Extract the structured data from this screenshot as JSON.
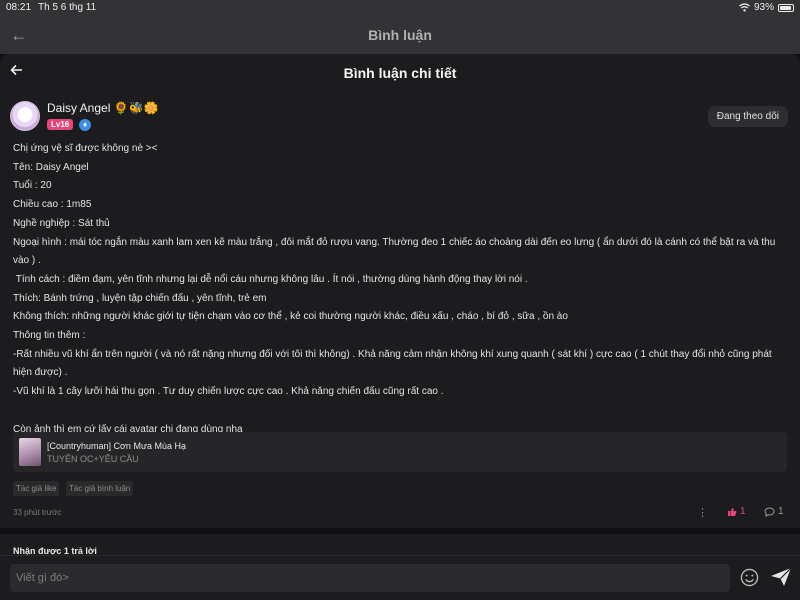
{
  "status_bar": {
    "time": "08:21",
    "date": "Th 5 6 thg 11",
    "battery": "93%",
    "battery_level": 0.93
  },
  "background_header": {
    "title": "Bình luận"
  },
  "sheet": {
    "title": "Bình luận chi tiết"
  },
  "user": {
    "name": "Daisy Angel 🌻🐝🌼",
    "level": "Lv16",
    "follow_label": "Đang theo dõi"
  },
  "comment": {
    "lines": [
      "Chị ứng vệ sĩ được không nè ><",
      "Tên: Daisy Angel",
      "Tuổi : 20",
      "Chiều cao : 1m85",
      "Nghề nghiệp : Sát thủ",
      "Ngoại hình : mái tóc ngắn màu xanh lam xen kẽ màu trắng , đôi mắt đỏ rượu vang. Thường đeo 1 chiếc áo choàng dài đến eo lưng ( ẩn dưới đó là cánh có thể bật ra và thu vào ) .",
      " Tính cách : điềm đạm, yên tĩnh nhưng lại dễ nổi cáu nhưng không lâu . Ít nói , thường dùng hành động thay lời nói .",
      "Thích: Bánh trứng , luyện tập chiến đấu , yên tĩnh, trẻ em",
      "Không thích: những người khác giới tự tiện chạm vào cơ thể , kẻ coi thường người khác, điều xấu , cháo , bí đỏ , sữa , ồn ào",
      "Thông tin thêm :",
      "-Rất nhiều vũ khí ẩn trên người ( và nó rất nặng nhưng đối với tôi thì không) . Khả năng cảm nhận không khí xung quanh ( sát khí ) cực cao ( 1 chút thay đổi nhỏ cũng phát hiện được) .",
      "-Vũ khí là 1 cây lưỡi hái thu gọn . Tư duy chiến lược cực cao . Khả năng chiến đấu cũng rất cao .",
      "",
      "Còn ảnh thì em cứ lấy cái avatar chị đang dùng nha"
    ]
  },
  "story": {
    "title": "[Countryhuman] Cơn Mưa Mùa Hạ",
    "subtitle": "TUYỂN OC+YÊU CẦU"
  },
  "tags": [
    "Tác giả like",
    "Tác giả bình luận"
  ],
  "meta": {
    "timestamp": "33 phút trước",
    "likes": "1",
    "replies": "1"
  },
  "replies_header": "Nhận được 1 trả lời",
  "input": {
    "placeholder": "Viết gì đó>"
  },
  "colors": {
    "accent": "#e8457c",
    "background": "#1c1c1e",
    "level_badge": "#e8457c",
    "verified": "#3b8ee8"
  }
}
